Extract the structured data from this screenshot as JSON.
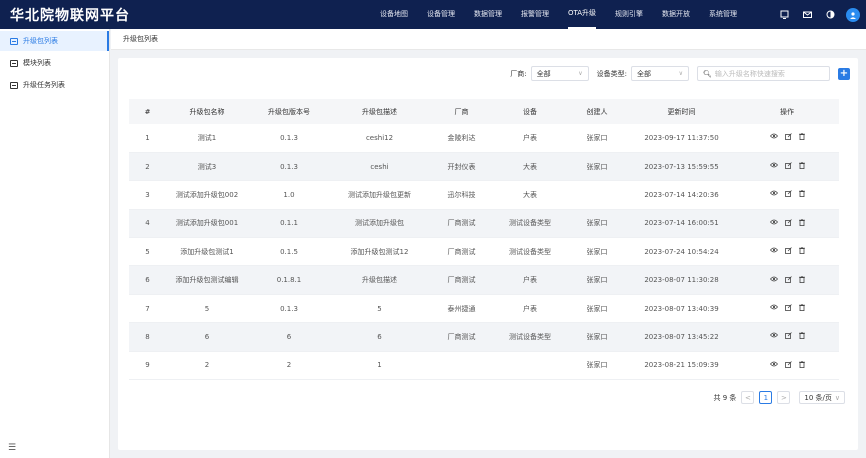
{
  "app": {
    "title": "华北院物联网平台"
  },
  "nav": {
    "items": [
      "设备地图",
      "设备管理",
      "数据管理",
      "报警管理",
      "OTA升级",
      "规则引擎",
      "数据开放",
      "系统管理"
    ],
    "active": "OTA升级"
  },
  "header_icons": [
    "screen-icon",
    "mail-icon",
    "theme-icon",
    "avatar"
  ],
  "sidebar": {
    "items": [
      {
        "label": "升级包列表",
        "active": true
      },
      {
        "label": "模块列表",
        "active": false
      },
      {
        "label": "升级任务列表",
        "active": false
      }
    ]
  },
  "breadcrumb": "升级包列表",
  "filters": {
    "vendor_label": "厂商:",
    "vendor_value": "全部",
    "device_type_label": "设备类型:",
    "device_type_value": "全部",
    "search_placeholder": "输入升级名称快速搜索"
  },
  "table": {
    "columns": [
      "#",
      "升级包名称",
      "升级包版本号",
      "升级包描述",
      "厂商",
      "设备",
      "创建人",
      "更新时间",
      "操作"
    ],
    "rows": [
      [
        "1",
        "测试1",
        "0.1.3",
        "ceshi12",
        "金陵利达",
        "户表",
        "张家口",
        "2023-09-17 11:37:50"
      ],
      [
        "2",
        "测试3",
        "0.1.3",
        "ceshi",
        "开封仪表",
        "大表",
        "张家口",
        "2023-07-13 15:59:55"
      ],
      [
        "3",
        "测试添加升级包002",
        "1.0",
        "测试添加升级包更新",
        "迅尔科技",
        "大表",
        "",
        "2023-07-14 14:20:36"
      ],
      [
        "4",
        "测试添加升级包001",
        "0.1.1",
        "测试添加升级包",
        "厂商测试",
        "测试设备类型",
        "张家口",
        "2023-07-14 16:00:51"
      ],
      [
        "5",
        "添加升级包测试1",
        "0.1.5",
        "添加升级包测试12",
        "厂商测试",
        "测试设备类型",
        "张家口",
        "2023-07-24 10:54:24"
      ],
      [
        "6",
        "添加升级包测试编辑",
        "0.1.8.1",
        "升级包描述",
        "厂商测试",
        "户表",
        "张家口",
        "2023-08-07 11:30:28"
      ],
      [
        "7",
        "5",
        "0.1.3",
        "5",
        "泰州捷通",
        "户表",
        "张家口",
        "2023-08-07 13:40:39"
      ],
      [
        "8",
        "6",
        "6",
        "6",
        "厂商测试",
        "测试设备类型",
        "张家口",
        "2023-08-07 13:45:22"
      ],
      [
        "9",
        "2",
        "2",
        "1",
        "",
        "",
        "张家口",
        "2023-08-21 15:09:39"
      ]
    ]
  },
  "pagination": {
    "total": "共 9 条",
    "current": "1",
    "page_size": "10 条/页"
  }
}
